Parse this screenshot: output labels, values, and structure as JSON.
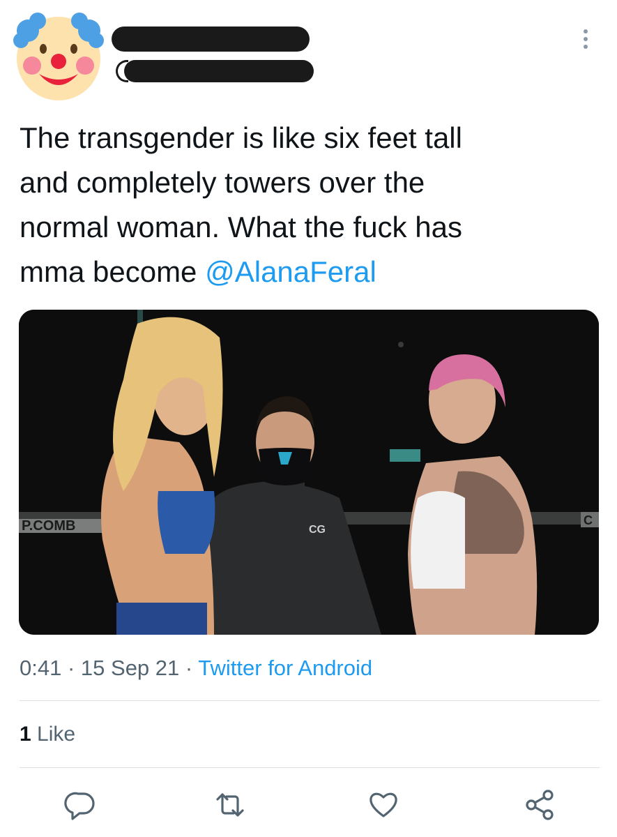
{
  "tweet": {
    "text_line1": "The transgender is like six feet tall",
    "text_line2": "and completely towers over the",
    "text_line3": "normal woman. What the fuck has",
    "text_line4_prefix": "mma become ",
    "mention": "@AlanaFeral"
  },
  "media": {
    "banner_left": "P.COMB",
    "banner_right": "C"
  },
  "meta": {
    "time": "0:41",
    "separator": "·",
    "date": "15 Sep 21",
    "source": "Twitter for Android"
  },
  "stats": {
    "like_count": "1",
    "like_label": "Like"
  },
  "icons": {
    "avatar": "clown-emoji-icon",
    "more": "more-options-icon",
    "reply": "reply-icon",
    "retweet": "retweet-icon",
    "like": "heart-icon",
    "share": "share-icon"
  },
  "colors": {
    "accent": "#1d9bf0",
    "secondary_text": "#536471",
    "icon": "#536471"
  }
}
